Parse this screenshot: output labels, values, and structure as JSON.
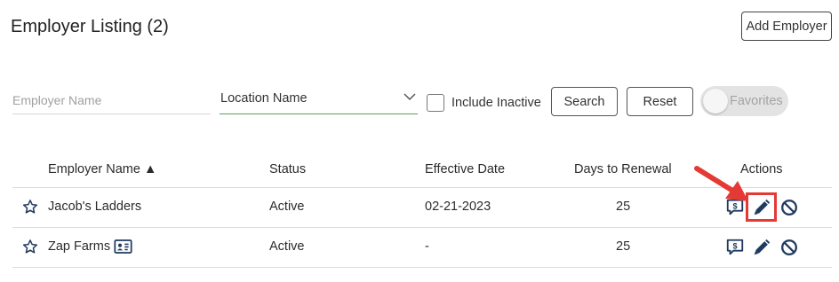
{
  "header": {
    "title": "Employer Listing (2)",
    "add_button": "Add Employer"
  },
  "filters": {
    "employer_name_placeholder": "Employer Name",
    "location_value": "Location Name",
    "include_inactive_label": "Include Inactive",
    "include_inactive_checked": false,
    "search_button": "Search",
    "reset_button": "Reset",
    "favorites_label": "Favorites",
    "favorites_on": false
  },
  "table": {
    "columns": {
      "employer_name": "Employer Name ▲",
      "status": "Status",
      "effective_date": "Effective Date",
      "days_to_renewal": "Days to Renewal",
      "actions": "Actions"
    },
    "rows": [
      {
        "name": "Jacob's Ladders",
        "status": "Active",
        "effective_date": "02-21-2023",
        "days_to_renewal": "25"
      },
      {
        "name": "Zap Farms",
        "status": "Active",
        "effective_date": "-",
        "days_to_renewal": "25"
      }
    ]
  },
  "colors": {
    "text": "#2b2b2b",
    "icon": "#1f3a5f",
    "select_underline": "#5aa05a",
    "annotation_red": "#e53935"
  },
  "icons": [
    "star-icon",
    "contact-card-icon",
    "billing-icon",
    "edit-pencil-icon",
    "ban-icon",
    "chevron-down-icon",
    "pointer-arrow-annotation"
  ]
}
